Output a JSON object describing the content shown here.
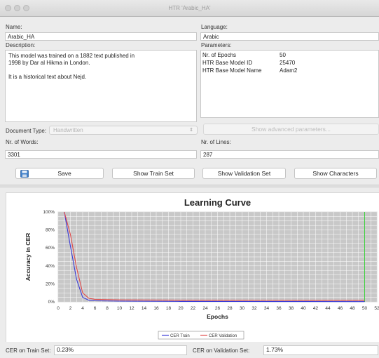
{
  "window": {
    "title": "HTR 'Arabic_HA'"
  },
  "left": {
    "name_label": "Name:",
    "name_value": "Arabic_HA",
    "description_label": "Description:",
    "description_value": "This model was trained on a 1882 text published in\n1998 by Dar al Hikma in London.\n\nIt is a historical text about Nejd.",
    "doc_type_label": "Document Type:",
    "doc_type_value": "Handwritten",
    "words_label": "Nr. of Words:",
    "words_value": "3301"
  },
  "right": {
    "language_label": "Language:",
    "language_value": "Arabic",
    "parameters_label": "Parameters:",
    "params": [
      {
        "key": "Nr. of Epochs",
        "value": "50"
      },
      {
        "key": "HTR Base Model ID",
        "value": "25470"
      },
      {
        "key": "HTR Base Model Name",
        "value": "Adam2"
      }
    ],
    "advanced_button": "Show advanced parameters...",
    "lines_label": "Nr. of Lines:",
    "lines_value": "287"
  },
  "buttons": {
    "save": "Save",
    "train_set": "Show Train Set",
    "validation_set": "Show Validation Set",
    "characters": "Show Characters"
  },
  "footer": {
    "cer_train_label": "CER on Train Set:",
    "cer_train_value": "0.23%",
    "cer_val_label": "CER on Validation Set:",
    "cer_val_value": "1.73%"
  },
  "colors": {
    "train": "#3a3ad6",
    "validation": "#e04a4a",
    "marker": "#3cd23c",
    "plot_bg": "#c8c8c8"
  },
  "chart_data": {
    "type": "line",
    "title": "Learning Curve",
    "xlabel": "Epochs",
    "ylabel": "Accuracy in CER",
    "xlim": [
      0,
      52
    ],
    "ylim": [
      0,
      100
    ],
    "xticks": [
      "0",
      "2",
      "4",
      "6",
      "8",
      "10",
      "12",
      "14",
      "16",
      "18",
      "20",
      "22",
      "24",
      "26",
      "28",
      "30",
      "32",
      "34",
      "36",
      "38",
      "40",
      "42",
      "44",
      "46",
      "48",
      "50",
      "52"
    ],
    "yticks": [
      "0%",
      "20%",
      "40%",
      "60%",
      "80%",
      "100%"
    ],
    "marker_x": 50,
    "series": [
      {
        "name": "CER Train",
        "x": [
          1,
          2,
          3,
          4,
          5,
          6,
          10,
          20,
          30,
          40,
          50
        ],
        "y": [
          100,
          62,
          25,
          5,
          1.8,
          1.2,
          0.8,
          0.5,
          0.4,
          0.3,
          0.23
        ]
      },
      {
        "name": "CER Validation",
        "x": [
          1,
          2,
          3,
          4,
          5,
          6,
          10,
          20,
          30,
          40,
          50
        ],
        "y": [
          100,
          75,
          38,
          10,
          4,
          2.8,
          2.2,
          1.9,
          1.8,
          1.75,
          1.73
        ]
      }
    ]
  }
}
